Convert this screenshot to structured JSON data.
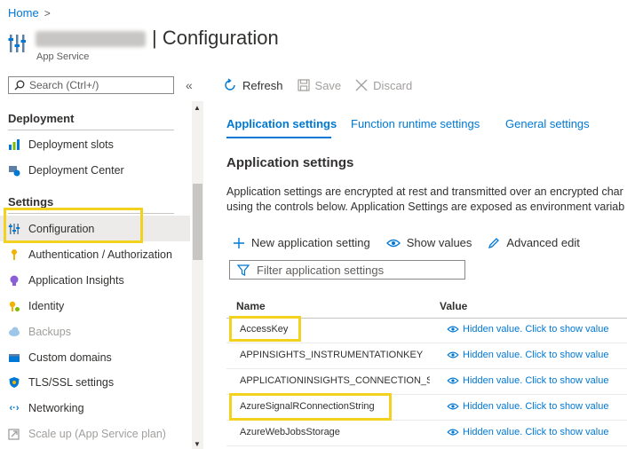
{
  "breadcrumb": {
    "home": "Home",
    "separator": ">"
  },
  "header": {
    "title": "| Configuration",
    "subtitle": "App Service"
  },
  "sidebar": {
    "search_placeholder": "Search (Ctrl+/)",
    "collapse_glyph": "«",
    "sections": [
      {
        "label": "Deployment",
        "items": [
          {
            "label": "Deployment slots",
            "icon": "deployment-slots-icon"
          },
          {
            "label": "Deployment Center",
            "icon": "deployment-center-icon"
          }
        ]
      },
      {
        "label": "Settings",
        "items": [
          {
            "label": "Configuration",
            "icon": "configuration-icon",
            "active": true
          },
          {
            "label": "Authentication / Authorization",
            "icon": "key-icon"
          },
          {
            "label": "Application Insights",
            "icon": "app-insights-icon"
          },
          {
            "label": "Identity",
            "icon": "identity-icon"
          },
          {
            "label": "Backups",
            "icon": "cloud-backup-icon",
            "disabled": true
          },
          {
            "label": "Custom domains",
            "icon": "custom-domains-icon"
          },
          {
            "label": "TLS/SSL settings",
            "icon": "shield-icon"
          },
          {
            "label": "Networking",
            "icon": "networking-icon"
          },
          {
            "label": "Scale up (App Service plan)",
            "icon": "scale-up-icon",
            "disabled": true
          }
        ]
      }
    ]
  },
  "toolbar": {
    "refresh": "Refresh",
    "save": "Save",
    "discard": "Discard"
  },
  "tabs": [
    "Application settings",
    "Function runtime settings",
    "General settings"
  ],
  "main": {
    "heading": "Application settings",
    "description_line1": "Application settings are encrypted at rest and transmitted over an encrypted char",
    "description_line2": "using the controls below. Application Settings are exposed as environment variab",
    "actions": {
      "new_setting": "New application setting",
      "show_values": "Show values",
      "advanced_edit": "Advanced edit"
    },
    "filter_placeholder": "Filter application settings"
  },
  "table": {
    "columns": [
      "Name",
      "Value"
    ],
    "rows": [
      {
        "name": "AccessKey",
        "value": "Hidden value. Click to show value",
        "highlighted": true
      },
      {
        "name": "APPINSIGHTS_INSTRUMENTATIONKEY",
        "value": "Hidden value. Click to show value"
      },
      {
        "name": "APPLICATIONINSIGHTS_CONNECTION_STRIN",
        "value": "Hidden value. Click to show value"
      },
      {
        "name": "AzureSignalRConnectionString",
        "value": "Hidden value. Click to show value",
        "highlighted": true
      },
      {
        "name": "AzureWebJobsStorage",
        "value": "Hidden value. Click to show value"
      }
    ]
  },
  "colors": {
    "accent": "#0078d4",
    "highlight": "#f2d11f",
    "text": "#323130",
    "muted": "#a19f9d"
  }
}
